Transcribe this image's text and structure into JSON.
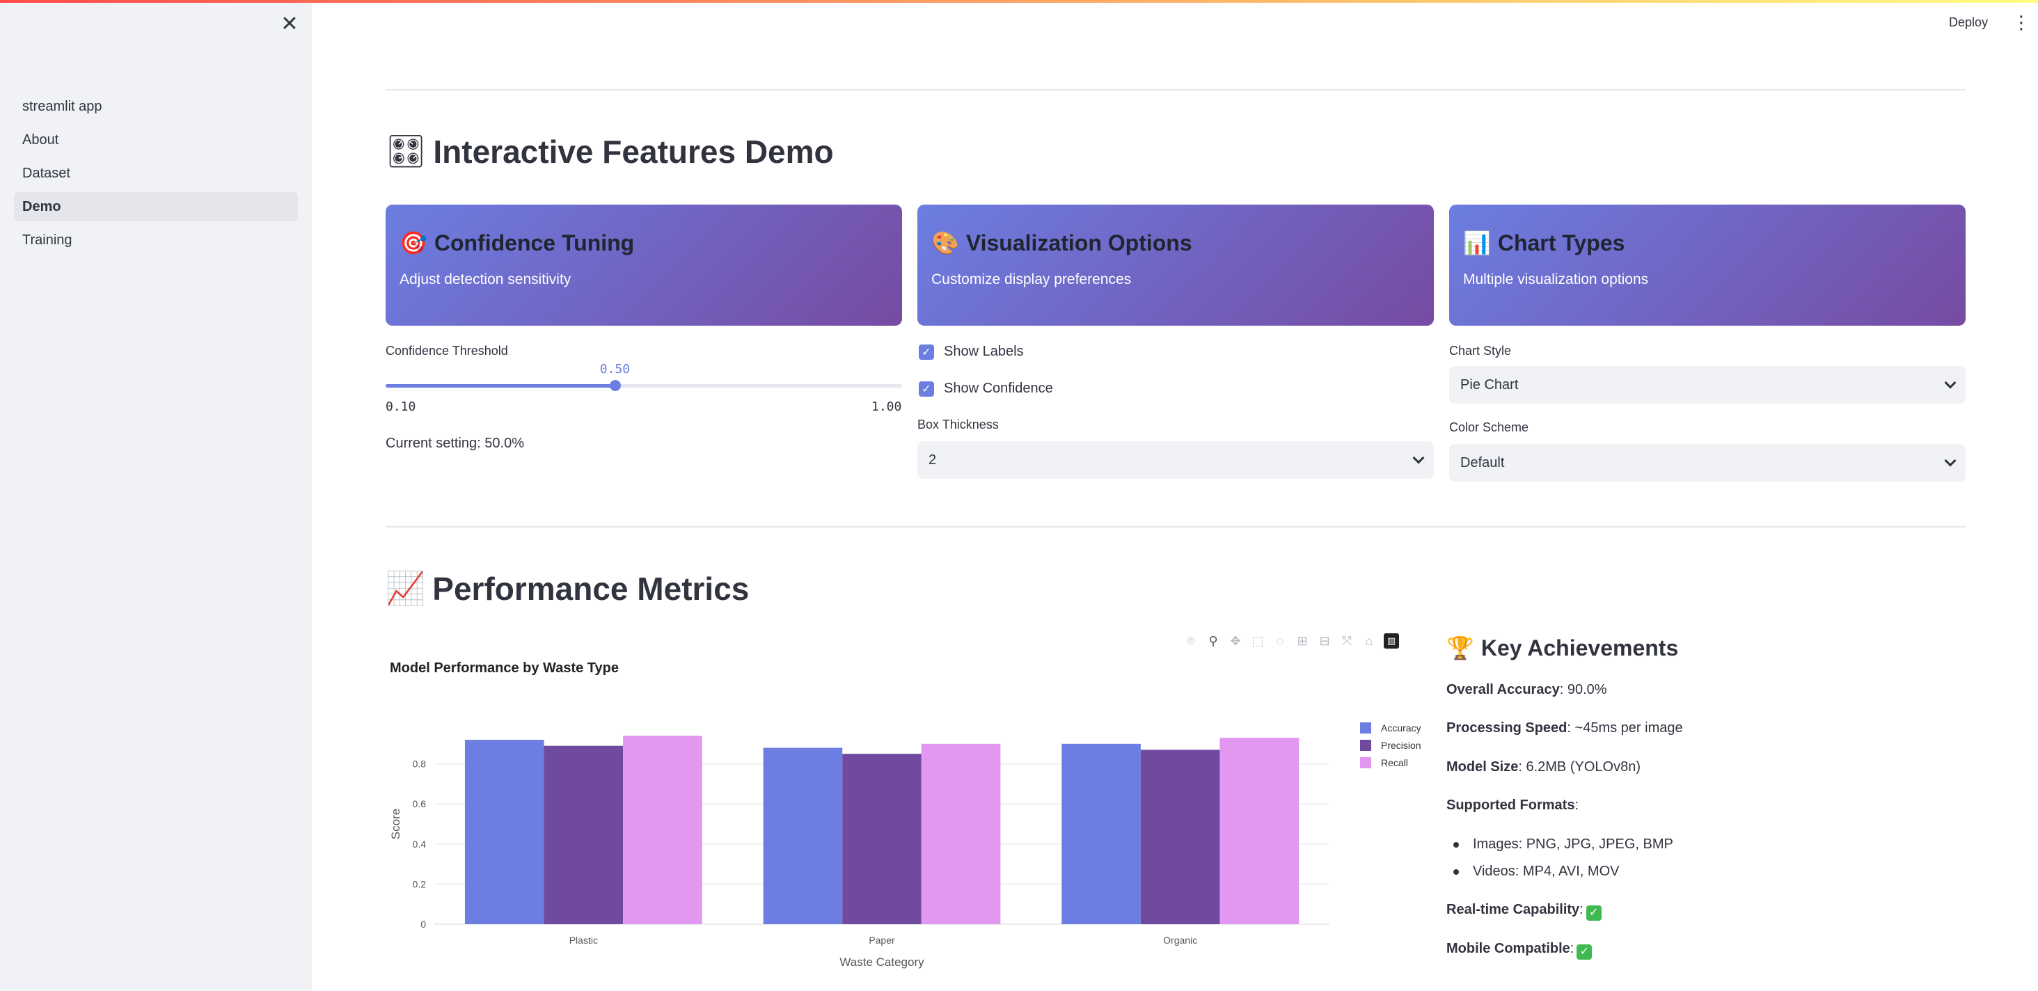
{
  "sidebar": {
    "items": [
      {
        "label": "streamlit app",
        "active": false
      },
      {
        "label": "About",
        "active": false
      },
      {
        "label": "Dataset",
        "active": false
      },
      {
        "label": "Demo",
        "active": true
      },
      {
        "label": "Training",
        "active": false
      }
    ]
  },
  "header": {
    "deploy_label": "Deploy"
  },
  "features": {
    "title": "Interactive Features Demo",
    "icon": "control-knobs-icon",
    "cards": [
      {
        "title": "Confidence Tuning",
        "desc": "Adjust detection sensitivity",
        "icon": "target-icon"
      },
      {
        "title": "Visualization Options",
        "desc": "Customize display preferences",
        "icon": "palette-icon"
      },
      {
        "title": "Chart Types",
        "desc": "Multiple visualization options",
        "icon": "bar-chart-icon"
      }
    ]
  },
  "confidence": {
    "label": "Confidence Threshold",
    "value": 0.5,
    "value_text": "0.50",
    "min": 0.1,
    "min_text": "0.10",
    "max": 1.0,
    "max_text": "1.00",
    "current_text": "Current setting: 50.0%"
  },
  "visual_options": {
    "show_labels": "Show Labels",
    "show_confidence": "Show Confidence",
    "box_thickness_label": "Box Thickness",
    "box_thickness_value": "2"
  },
  "chart_options": {
    "style_label": "Chart Style",
    "style_value": "Pie Chart",
    "scheme_label": "Color Scheme",
    "scheme_value": "Default"
  },
  "performance": {
    "title": "Performance Metrics",
    "icon": "chart-increasing-icon"
  },
  "colors": {
    "accuracy": "#6c7ee1",
    "precision": "#6f4a9f",
    "recall": "#e297f0"
  },
  "chart_data": {
    "type": "bar",
    "title": "Model Performance by Waste Type",
    "xlabel": "Waste Category",
    "ylabel": "Score",
    "categories": [
      "Plastic",
      "Paper",
      "Organic"
    ],
    "series": [
      {
        "name": "Accuracy",
        "values": [
          0.92,
          0.88,
          0.9
        ]
      },
      {
        "name": "Precision",
        "values": [
          0.89,
          0.85,
          0.87
        ]
      },
      {
        "name": "Recall",
        "values": [
          0.94,
          0.9,
          0.93
        ]
      }
    ],
    "ylim": [
      0,
      1.0
    ],
    "yticks": [
      0,
      0.2,
      0.4,
      0.6,
      0.8
    ],
    "ytick_labels": [
      "0",
      "0.2",
      "0.4",
      "0.6",
      "0.8"
    ],
    "grid": true,
    "legend": "top-right"
  },
  "achievements": {
    "title": "Key Achievements",
    "icon": "trophy-icon",
    "accuracy_label": "Overall Accuracy",
    "accuracy_value": ": 90.0%",
    "speed_label": "Processing Speed",
    "speed_value": ": ~45ms per image",
    "size_label": "Model Size",
    "size_value": ": 6.2MB (YOLOv8n)",
    "formats_label": "Supported Formats",
    "formats_suffix": ":",
    "formats": [
      "Images: PNG, JPG, JPEG, BMP",
      "Videos: MP4, AVI, MOV"
    ],
    "realtime_label": "Real-time Capability",
    "mobile_label": "Mobile Compatible",
    "colon": ":"
  }
}
